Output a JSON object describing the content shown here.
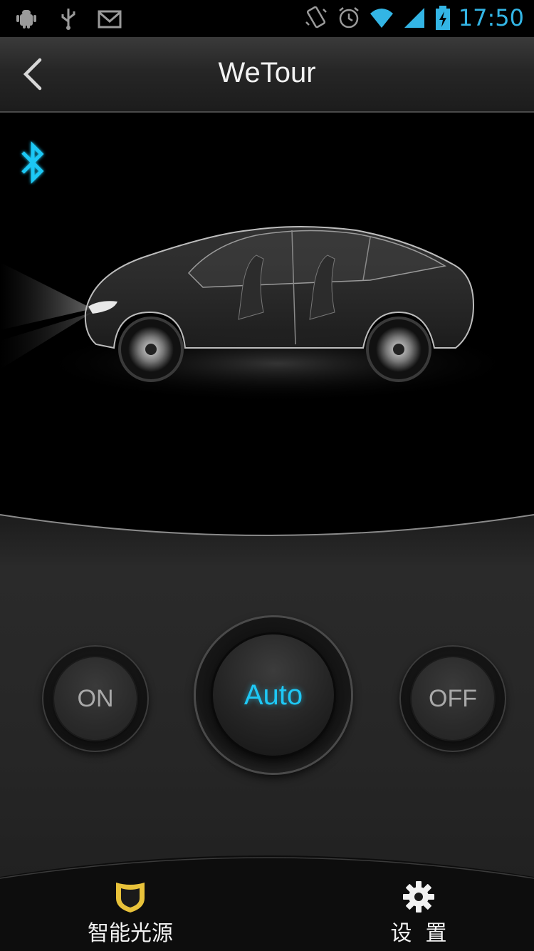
{
  "status_bar": {
    "time": "17:50",
    "left_icons": [
      "android-debug-icon",
      "usb-icon",
      "gmail-icon"
    ],
    "right_icons": [
      "vibrate-icon",
      "alarm-icon",
      "wifi-icon",
      "signal-icon",
      "battery-charging-icon"
    ]
  },
  "header": {
    "title": "WeTour",
    "back_icon": "chevron-left-icon"
  },
  "scene": {
    "bluetooth_icon": "bluetooth-icon",
    "bluetooth_color": "#1ec8f5"
  },
  "controls": {
    "on_label": "ON",
    "auto_label": "Auto",
    "off_label": "OFF",
    "active": "Auto",
    "active_color": "#1ec8f5"
  },
  "nav": {
    "items": [
      {
        "label": "智能光源",
        "icon": "shield-icon",
        "active": true
      },
      {
        "label": "设  置",
        "icon": "gear-icon",
        "active": false
      }
    ],
    "active_color": "#e8c23a"
  }
}
